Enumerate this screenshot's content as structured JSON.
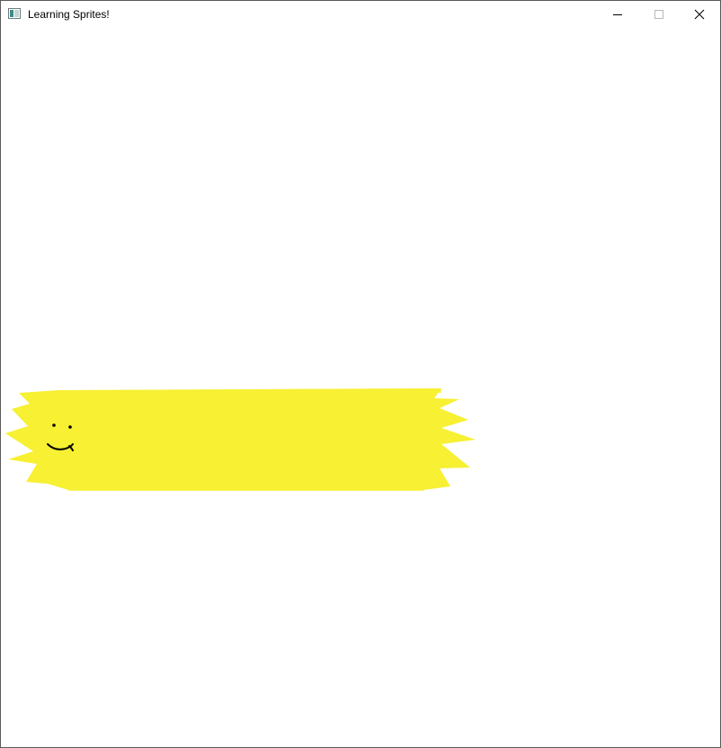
{
  "window": {
    "title": "Learning Sprites!",
    "controls": {
      "minimize_icon": "minimize-icon",
      "maximize_icon": "maximize-icon",
      "close_icon": "close-icon"
    }
  },
  "scene": {
    "background_color": "#ffffff",
    "sprite": {
      "description_icon": "smiley-sun-sprite",
      "fill_color": "#f7f033",
      "face_color": "#000000"
    }
  }
}
